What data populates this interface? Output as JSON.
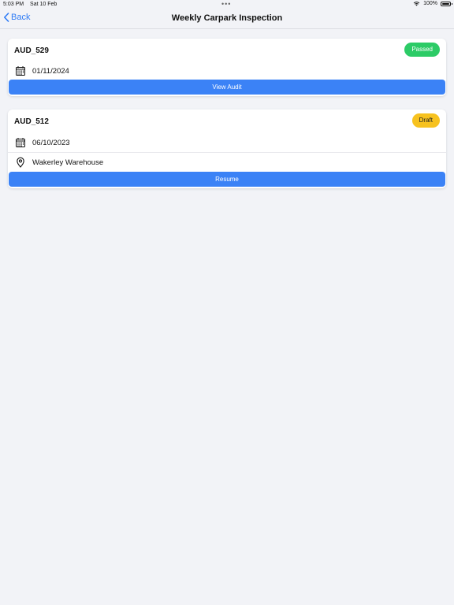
{
  "status_bar": {
    "time": "5:03 PM",
    "date": "Sat 10 Feb",
    "battery": "100%",
    "icons": [
      "wifi-icon",
      "battery-icon"
    ]
  },
  "nav": {
    "back_label": "Back",
    "title": "Weekly Carpark Inspection"
  },
  "audits": [
    {
      "id": "AUD_529",
      "status": "Passed",
      "date": "01/11/2024",
      "button_label": "View Audit"
    },
    {
      "id": "AUD_512",
      "status": "Draft",
      "date": "06/10/2023",
      "location": "Wakerley Warehouse",
      "button_label": "Resume"
    }
  ],
  "colors": {
    "accent": "#3b82f6",
    "passed": "#2ccb66",
    "draft": "#f7c21f",
    "background": "#f2f3f7"
  }
}
